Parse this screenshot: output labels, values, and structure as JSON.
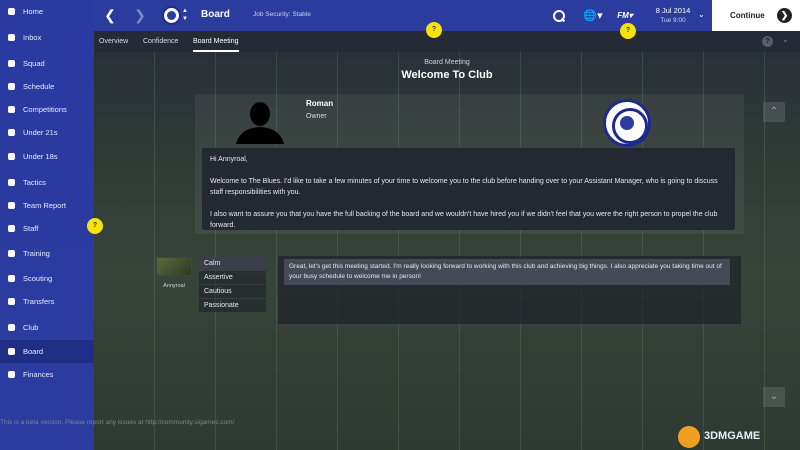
{
  "sidebar": {
    "items": [
      {
        "label": "Home",
        "icon": "home-icon"
      },
      {
        "label": "Inbox",
        "icon": "inbox-icon"
      },
      {
        "label": "Squad",
        "icon": "squad-icon"
      },
      {
        "label": "Schedule",
        "icon": "calendar-icon"
      },
      {
        "label": "Competitions",
        "icon": "trophy-icon"
      },
      {
        "label": "Under 21s",
        "icon": "u21-icon"
      },
      {
        "label": "Under 18s",
        "icon": "u18-icon"
      },
      {
        "label": "Tactics",
        "icon": "tactics-icon"
      },
      {
        "label": "Team Report",
        "icon": "report-icon"
      },
      {
        "label": "Staff",
        "icon": "staff-icon"
      },
      {
        "label": "Training",
        "icon": "training-icon"
      },
      {
        "label": "Scouting",
        "icon": "scouting-icon"
      },
      {
        "label": "Transfers",
        "icon": "transfers-icon"
      },
      {
        "label": "Club",
        "icon": "club-shield-icon"
      },
      {
        "label": "Board",
        "icon": "board-icon"
      },
      {
        "label": "Finances",
        "icon": "finances-icon"
      }
    ],
    "active": "Board"
  },
  "topbar": {
    "title": "Board",
    "subtitle": "Job Security: Stable",
    "fm_label": "FM",
    "date": "8 Jul 2014",
    "time": "Tue 9:00",
    "continue_label": "Continue"
  },
  "tabs": [
    "Overview",
    "Confidence",
    "Board Meeting"
  ],
  "active_tab": "Board Meeting",
  "help_label": "?",
  "hint_label": "?",
  "meeting": {
    "subtitle": "Board Meeting",
    "title": "Welcome To Club",
    "owner_name": "Roman",
    "owner_role": "Owner",
    "speech": [
      "Hi Annyroal,",
      "Welcome to The Blues. I'd like to take a few minutes of your time to welcome you to the club before handing over to your Assistant Manager, who is going to discuss staff responsibilities with you.",
      "I also want to assure you that you have the full backing of the board and we wouldn't have hired you if we didn't feel that you were the right person to propel the club forward."
    ]
  },
  "player": {
    "name": "Annyroal",
    "tones": [
      "Calm",
      "Assertive",
      "Cautious",
      "Passionate"
    ],
    "selected_tone": "Calm",
    "reply": "Great, let's get this meeting started. I'm really looking forward to working with this club and achieving big things. I also appreciate you taking time out of your busy schedule to welcome me in person!"
  },
  "beta_note": "This is a beta version. Please report any issues at http://community.sigames.com/",
  "watermark": "3DMGAME",
  "colors": {
    "sidebar": "#2a3aa0",
    "topbar": "#2c3b9e",
    "hint": "#f5e30b"
  }
}
